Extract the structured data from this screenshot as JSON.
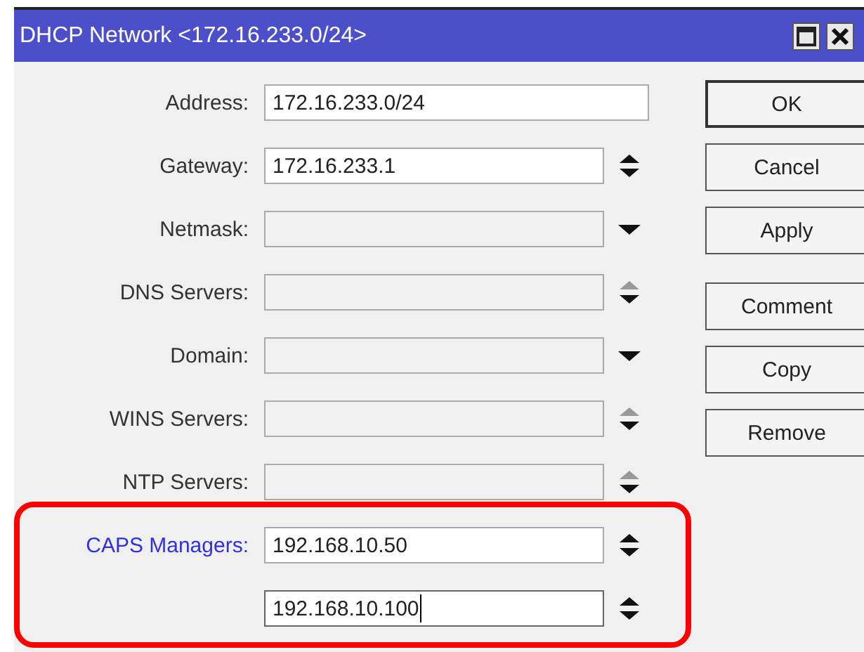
{
  "window": {
    "title": "DHCP Network <172.16.233.0/24>"
  },
  "fields": [
    {
      "label": "Address:",
      "value": "172.16.233.0/24",
      "kind": "plain",
      "set": true,
      "highlighted": false,
      "focused": false
    },
    {
      "label": "Gateway:",
      "value": "172.16.233.1",
      "kind": "updown",
      "set": true,
      "highlighted": false,
      "focused": false
    },
    {
      "label": "Netmask:",
      "kind": "dropdown",
      "set": false,
      "highlighted": false,
      "focused": false
    },
    {
      "label": "DNS Servers:",
      "kind": "down",
      "set": false,
      "highlighted": false,
      "focused": false
    },
    {
      "label": "Domain:",
      "kind": "dropdown",
      "set": false,
      "highlighted": false,
      "focused": false
    },
    {
      "label": "WINS Servers:",
      "kind": "down",
      "set": false,
      "highlighted": false,
      "focused": false
    },
    {
      "label": "NTP Servers:",
      "kind": "down",
      "set": false,
      "highlighted": false,
      "focused": false
    },
    {
      "label": "CAPS Managers:",
      "value": "192.168.10.50",
      "kind": "updown",
      "set": true,
      "highlighted": true,
      "focused": false
    },
    {
      "value": "192.168.10.100",
      "kind": "updown",
      "set": true,
      "focused": true
    }
  ],
  "button_groups": [
    [
      "OK",
      "Cancel",
      "Apply"
    ],
    [
      "Comment",
      "Copy",
      "Remove"
    ]
  ]
}
